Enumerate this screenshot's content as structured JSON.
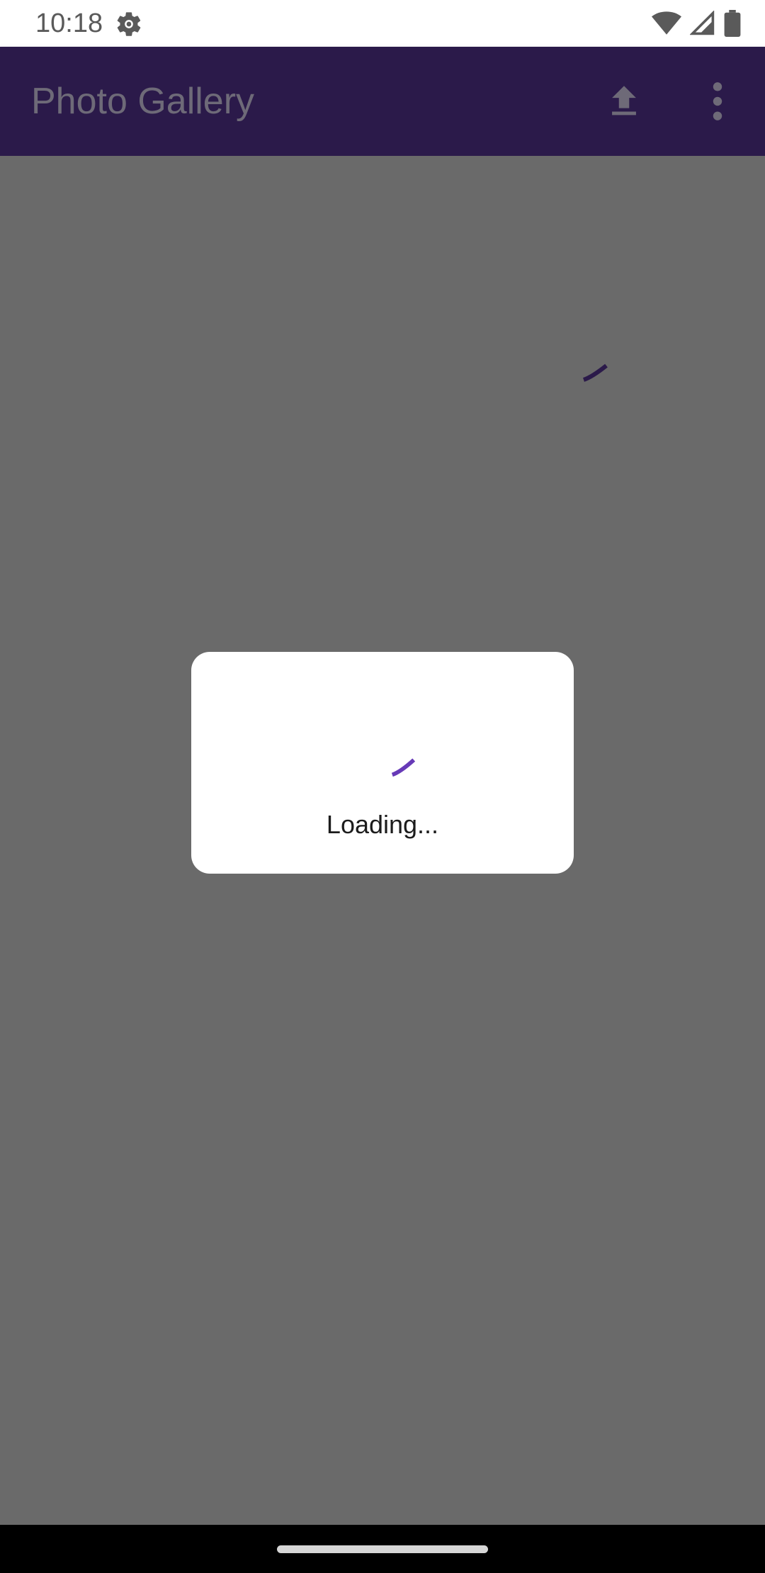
{
  "status_bar": {
    "time": "10:18",
    "icons": [
      "settings-gear-icon",
      "wifi-icon",
      "signal-icon",
      "battery-icon"
    ]
  },
  "app_bar": {
    "title": "Photo Gallery",
    "actions": [
      "upload-icon",
      "more-vert-icon"
    ]
  },
  "dialog": {
    "message": "Loading..."
  },
  "colors": {
    "app_bar_bg": "#2b1a4a",
    "scrim": "#6a6a6a",
    "accent_purple": "#673ab7",
    "dialog_bg": "#ffffff"
  }
}
